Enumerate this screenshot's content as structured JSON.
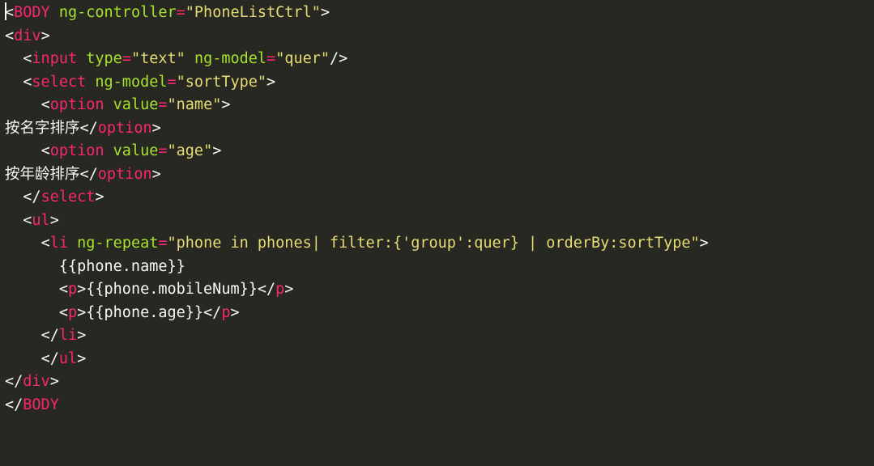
{
  "code": {
    "tokens": [
      {
        "t": "punct",
        "v": "<"
      },
      {
        "t": "tag",
        "v": "BODY"
      },
      {
        "t": "txt",
        "v": " "
      },
      {
        "t": "attr",
        "v": "ng-controller"
      },
      {
        "t": "op",
        "v": "="
      },
      {
        "t": "str",
        "v": "\"PhoneListCtrl\""
      },
      {
        "t": "punct",
        "v": ">"
      },
      {
        "t": "nl"
      },
      {
        "t": "punct",
        "v": "<"
      },
      {
        "t": "tag",
        "v": "div"
      },
      {
        "t": "punct",
        "v": ">"
      },
      {
        "t": "nl"
      },
      {
        "t": "txt",
        "v": "  "
      },
      {
        "t": "punct",
        "v": "<"
      },
      {
        "t": "tag",
        "v": "input"
      },
      {
        "t": "txt",
        "v": " "
      },
      {
        "t": "attr",
        "v": "type"
      },
      {
        "t": "op",
        "v": "="
      },
      {
        "t": "str",
        "v": "\"text\""
      },
      {
        "t": "txt",
        "v": " "
      },
      {
        "t": "attr",
        "v": "ng-model"
      },
      {
        "t": "op",
        "v": "="
      },
      {
        "t": "str",
        "v": "\"quer\""
      },
      {
        "t": "punct",
        "v": "/>"
      },
      {
        "t": "nl"
      },
      {
        "t": "txt",
        "v": "  "
      },
      {
        "t": "punct",
        "v": "<"
      },
      {
        "t": "tag",
        "v": "select"
      },
      {
        "t": "txt",
        "v": " "
      },
      {
        "t": "attr",
        "v": "ng-model"
      },
      {
        "t": "op",
        "v": "="
      },
      {
        "t": "str",
        "v": "\"sortType\""
      },
      {
        "t": "punct",
        "v": ">"
      },
      {
        "t": "nl"
      },
      {
        "t": "txt",
        "v": "    "
      },
      {
        "t": "punct",
        "v": "<"
      },
      {
        "t": "tag",
        "v": "option"
      },
      {
        "t": "txt",
        "v": " "
      },
      {
        "t": "attr",
        "v": "value"
      },
      {
        "t": "op",
        "v": "="
      },
      {
        "t": "str",
        "v": "\"name\""
      },
      {
        "t": "punct",
        "v": ">"
      },
      {
        "t": "nl"
      },
      {
        "t": "txt",
        "v": "按名字排序"
      },
      {
        "t": "punct",
        "v": "</"
      },
      {
        "t": "tag",
        "v": "option"
      },
      {
        "t": "punct",
        "v": ">"
      },
      {
        "t": "nl"
      },
      {
        "t": "txt",
        "v": "    "
      },
      {
        "t": "punct",
        "v": "<"
      },
      {
        "t": "tag",
        "v": "option"
      },
      {
        "t": "txt",
        "v": " "
      },
      {
        "t": "attr",
        "v": "value"
      },
      {
        "t": "op",
        "v": "="
      },
      {
        "t": "str",
        "v": "\"age\""
      },
      {
        "t": "punct",
        "v": ">"
      },
      {
        "t": "nl"
      },
      {
        "t": "txt",
        "v": "按年龄排序"
      },
      {
        "t": "punct",
        "v": "</"
      },
      {
        "t": "tag",
        "v": "option"
      },
      {
        "t": "punct",
        "v": ">"
      },
      {
        "t": "nl"
      },
      {
        "t": "txt",
        "v": "  "
      },
      {
        "t": "punct",
        "v": "</"
      },
      {
        "t": "tag",
        "v": "select"
      },
      {
        "t": "punct",
        "v": ">"
      },
      {
        "t": "nl"
      },
      {
        "t": "txt",
        "v": "  "
      },
      {
        "t": "punct",
        "v": "<"
      },
      {
        "t": "tag",
        "v": "ul"
      },
      {
        "t": "punct",
        "v": ">"
      },
      {
        "t": "nl"
      },
      {
        "t": "txt",
        "v": "    "
      },
      {
        "t": "punct",
        "v": "<"
      },
      {
        "t": "tag",
        "v": "li"
      },
      {
        "t": "txt",
        "v": " "
      },
      {
        "t": "attr",
        "v": "ng-repeat"
      },
      {
        "t": "op",
        "v": "="
      },
      {
        "t": "str",
        "v": "\"phone in phones| filter:{'group':quer} | orderBy:sortType\""
      },
      {
        "t": "punct",
        "v": ">"
      },
      {
        "t": "nl"
      },
      {
        "t": "txt",
        "v": "      {{phone.name}}"
      },
      {
        "t": "nl"
      },
      {
        "t": "txt",
        "v": "      "
      },
      {
        "t": "punct",
        "v": "<"
      },
      {
        "t": "tag",
        "v": "p"
      },
      {
        "t": "punct",
        "v": ">"
      },
      {
        "t": "txt",
        "v": "{{phone.mobileNum}}"
      },
      {
        "t": "punct",
        "v": "</"
      },
      {
        "t": "tag",
        "v": "p"
      },
      {
        "t": "punct",
        "v": ">"
      },
      {
        "t": "nl"
      },
      {
        "t": "txt",
        "v": "      "
      },
      {
        "t": "punct",
        "v": "<"
      },
      {
        "t": "tag",
        "v": "p"
      },
      {
        "t": "punct",
        "v": ">"
      },
      {
        "t": "txt",
        "v": "{{phone.age}}"
      },
      {
        "t": "punct",
        "v": "</"
      },
      {
        "t": "tag",
        "v": "p"
      },
      {
        "t": "punct",
        "v": ">"
      },
      {
        "t": "nl"
      },
      {
        "t": "txt",
        "v": "    "
      },
      {
        "t": "punct",
        "v": "</"
      },
      {
        "t": "tag",
        "v": "li"
      },
      {
        "t": "punct",
        "v": ">"
      },
      {
        "t": "nl"
      },
      {
        "t": "txt",
        "v": "    "
      },
      {
        "t": "punct",
        "v": "</"
      },
      {
        "t": "tag",
        "v": "ul"
      },
      {
        "t": "punct",
        "v": ">"
      },
      {
        "t": "nl"
      },
      {
        "t": "punct",
        "v": "</"
      },
      {
        "t": "tag",
        "v": "div"
      },
      {
        "t": "punct",
        "v": ">"
      },
      {
        "t": "nl"
      },
      {
        "t": "punct",
        "v": "</"
      },
      {
        "t": "tag",
        "v": "BODY"
      }
    ]
  }
}
